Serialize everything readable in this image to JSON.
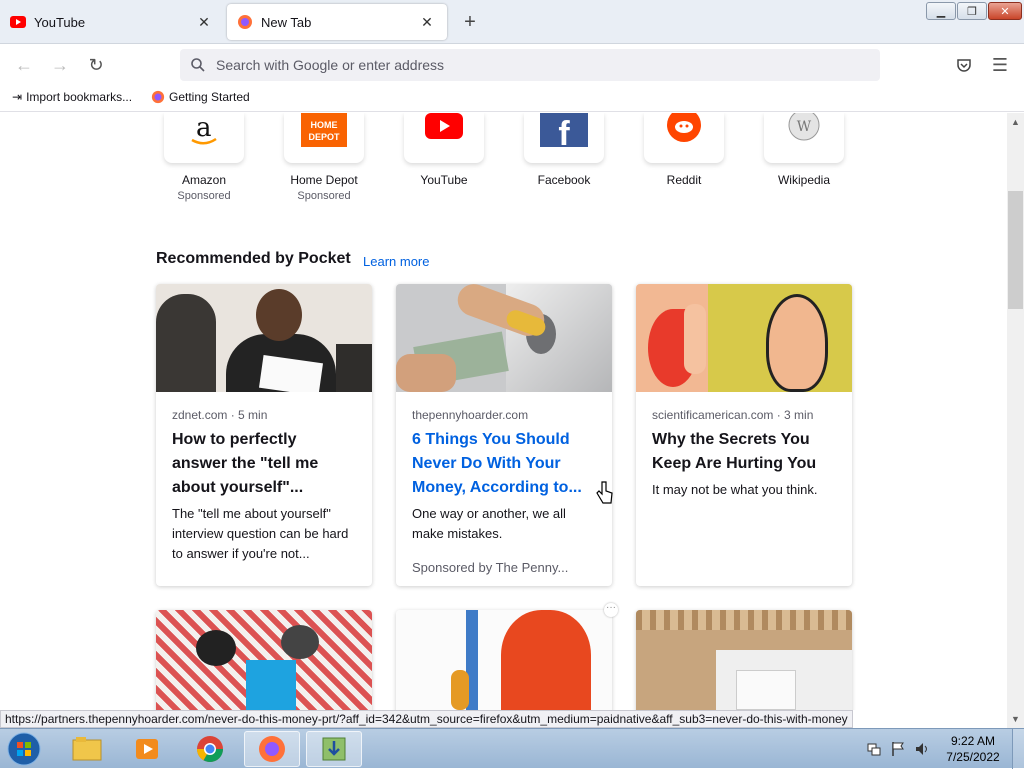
{
  "tabs": [
    {
      "label": "YouTube",
      "icon": "youtube-icon"
    },
    {
      "label": "New Tab",
      "icon": "firefox-icon"
    }
  ],
  "window_controls": {
    "minimize": "minimize-icon",
    "maximize": "restore-icon",
    "close": "close-icon"
  },
  "nav": {
    "search_placeholder": "Search with Google or enter address"
  },
  "bookmarks": [
    {
      "label": "Import bookmarks...",
      "icon": "import-icon"
    },
    {
      "label": "Getting Started",
      "icon": "firefox-icon"
    }
  ],
  "top_sites": [
    {
      "name": "Amazon",
      "sponsor": "Sponsored"
    },
    {
      "name": "Home Depot",
      "sponsor": "Sponsored"
    },
    {
      "name": "YouTube",
      "sponsor": ""
    },
    {
      "name": "Facebook",
      "sponsor": ""
    },
    {
      "name": "Reddit",
      "sponsor": ""
    },
    {
      "name": "Wikipedia",
      "sponsor": ""
    }
  ],
  "pocket": {
    "heading": "Recommended by Pocket",
    "learn_more": "Learn more",
    "cards": [
      {
        "source": "zdnet.com · 5 min",
        "title": "How to perfectly answer the \"tell me about yourself\"...",
        "excerpt": "The \"tell me about yourself\" interview question can be hard to answer if you're not...",
        "sponsored": ""
      },
      {
        "source": "thepennyhoarder.com",
        "title": "6 Things You Should Never Do With Your Money, According to...",
        "excerpt": "One way or another, we all make mistakes.",
        "sponsored": "Sponsored by The Penny..."
      },
      {
        "source": "scientificamerican.com · 3 min",
        "title": "Why the Secrets You Keep Are Hurting You",
        "excerpt": "It may not be what you think.",
        "sponsored": ""
      }
    ]
  },
  "status_url": "https://partners.thepennyhoarder.com/never-do-this-money-prt/?aff_id=342&utm_source=firefox&utm_medium=paidnative&aff_sub3=never-do-this-with-money",
  "taskbar": {
    "apps": [
      "file-explorer-icon",
      "media-player-icon",
      "chrome-icon",
      "firefox-icon",
      "downloader-icon"
    ],
    "time": "9:22 AM",
    "date": "7/25/2022"
  },
  "colors": {
    "accent": "#0061e0",
    "youtube": "#ff0000",
    "facebook": "#1877f2",
    "reddit": "#ff4500"
  }
}
